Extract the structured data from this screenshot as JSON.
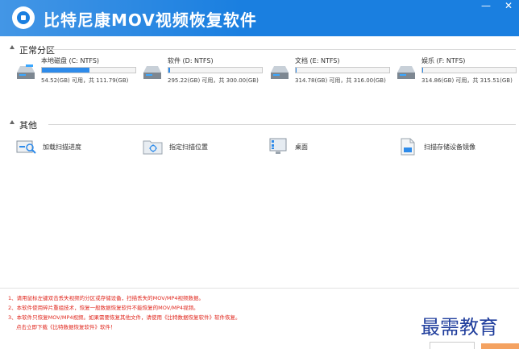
{
  "app": {
    "title": "比特尼康MOV视频恢复软件",
    "window_buttons": {
      "minimize": "—",
      "close": "✕"
    }
  },
  "sections": {
    "partitions": {
      "label": "正常分区"
    },
    "others": {
      "label": "其他"
    }
  },
  "drives": [
    {
      "name": "本地磁盘 (C: NTFS)",
      "info": "54.52(GB) 可用，共 111.79(GB)",
      "used_fraction": 0.51
    },
    {
      "name": "软件 (D: NTFS)",
      "info": "295.22(GB) 可用，共 300.00(GB)",
      "used_fraction": 0.02
    },
    {
      "name": "文档 (E: NTFS)",
      "info": "314.78(GB) 可用，共 316.00(GB)",
      "used_fraction": 0.004
    },
    {
      "name": "娱乐 (F: NTFS)",
      "info": "314.86(GB) 可用，共 315.51(GB)",
      "used_fraction": 0.002
    }
  ],
  "others": [
    {
      "label": "加载扫描进度",
      "icon": "load-progress-icon"
    },
    {
      "label": "指定扫描位置",
      "icon": "scan-location-icon"
    },
    {
      "label": "桌面",
      "icon": "desktop-icon"
    },
    {
      "label": "扫描存储设备镜像",
      "icon": "device-image-icon"
    }
  ],
  "notes": [
    "1、请用鼠标左键双击丢失视频的分区或存储设备，扫描丢失的MOV/MP4视频数据。",
    "2、本软件使用碎片重组技术，恢复一般数据恢复软件不能恢复的MOV/MP4视频。",
    "3、本软件只恢复MOV/MP4视频。如果需要恢复其他文件，请使用《比特数据恢复软件》软件恢复。",
    "点击立即下载《比特数据恢复软件》软件！"
  ],
  "watermark": "最需教育",
  "colors": {
    "titlebar": "#1a7fe0",
    "drive_fill": "#2e8bea",
    "note_text": "#e0261c",
    "watermark": "#1f3d9c"
  }
}
